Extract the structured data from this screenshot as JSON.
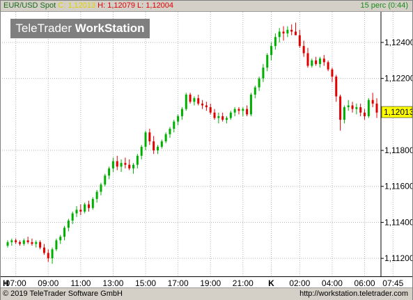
{
  "header": {
    "symbol": "EUR/USD Spot",
    "close": "C: 1,12013",
    "high": "H: 1,12079",
    "low": "L: 1,12004",
    "interval": "15 perc (0:44)"
  },
  "logo": {
    "part1": "TeleTrader ",
    "part2": "WorkStation"
  },
  "footer": {
    "copyright": "© 2019 TeleTrader Software GmbH",
    "url": "http://workstation.teletrader.com"
  },
  "colors": {
    "up": "#00b000",
    "down": "#e00000",
    "grid": "#b4b4b4",
    "price_tag": "#ffff00"
  },
  "chart_data": {
    "type": "candlestick",
    "title": "EUR/USD Spot",
    "interval": "15 perc",
    "last_price_label": "1,12013",
    "last_price": 1.12013,
    "ylim": [
      1.111,
      1.1257
    ],
    "y_ticks": [
      {
        "value": 1.124,
        "label": "1,12400"
      },
      {
        "value": 1.122,
        "label": "1,12200"
      },
      {
        "value": 1.118,
        "label": "1,11800"
      },
      {
        "value": 1.116,
        "label": "1,11600"
      },
      {
        "value": 1.114,
        "label": "1,11400"
      },
      {
        "value": 1.112,
        "label": "1,11200"
      }
    ],
    "x_ticks": [
      {
        "index": 0,
        "label": "H"
      },
      {
        "index": 2,
        "label": "07:00"
      },
      {
        "index": 10,
        "label": "09:00"
      },
      {
        "index": 18,
        "label": "11:00"
      },
      {
        "index": 26,
        "label": "13:00"
      },
      {
        "index": 34,
        "label": "15:00"
      },
      {
        "index": 42,
        "label": "17:00"
      },
      {
        "index": 50,
        "label": "19:00"
      },
      {
        "index": 58,
        "label": "21:00"
      },
      {
        "index": 65,
        "label": "K"
      },
      {
        "index": 72,
        "label": "02:00"
      },
      {
        "index": 80,
        "label": "04:00"
      },
      {
        "index": 88,
        "label": "06:00"
      },
      {
        "index": 95,
        "label": "07:45"
      }
    ],
    "grid": true,
    "candles": [
      [
        1.1127,
        1.113,
        1.1126,
        1.1129
      ],
      [
        1.1129,
        1.1131,
        1.1127,
        1.113
      ],
      [
        1.113,
        1.1131,
        1.1128,
        1.1129
      ],
      [
        1.1129,
        1.113,
        1.1127,
        1.1128
      ],
      [
        1.1128,
        1.1131,
        1.1127,
        1.113
      ],
      [
        1.113,
        1.1132,
        1.1128,
        1.1129
      ],
      [
        1.1129,
        1.1131,
        1.1127,
        1.1128
      ],
      [
        1.1128,
        1.113,
        1.1126,
        1.1129
      ],
      [
        1.1129,
        1.113,
        1.1125,
        1.1126
      ],
      [
        1.1126,
        1.1128,
        1.1122,
        1.1123
      ],
      [
        1.1123,
        1.1125,
        1.1118,
        1.112
      ],
      [
        1.112,
        1.1126,
        1.1117,
        1.1125
      ],
      [
        1.1125,
        1.1131,
        1.1124,
        1.113
      ],
      [
        1.113,
        1.1133,
        1.1128,
        1.1132
      ],
      [
        1.1132,
        1.1138,
        1.113,
        1.1137
      ],
      [
        1.1137,
        1.1142,
        1.1135,
        1.1141
      ],
      [
        1.1141,
        1.1146,
        1.1139,
        1.1145
      ],
      [
        1.1145,
        1.1149,
        1.1143,
        1.1147
      ],
      [
        1.1147,
        1.115,
        1.1144,
        1.1146
      ],
      [
        1.1146,
        1.1151,
        1.1145,
        1.115
      ],
      [
        1.115,
        1.1152,
        1.1146,
        1.1148
      ],
      [
        1.1148,
        1.1154,
        1.1147,
        1.1153
      ],
      [
        1.1153,
        1.1158,
        1.1151,
        1.1157
      ],
      [
        1.1157,
        1.1162,
        1.1155,
        1.1161
      ],
      [
        1.1161,
        1.1167,
        1.116,
        1.1166
      ],
      [
        1.1166,
        1.1171,
        1.1164,
        1.117
      ],
      [
        1.117,
        1.1176,
        1.1168,
        1.1174
      ],
      [
        1.1174,
        1.1177,
        1.1169,
        1.1171
      ],
      [
        1.1171,
        1.1175,
        1.1168,
        1.1173
      ],
      [
        1.1173,
        1.1176,
        1.117,
        1.1172
      ],
      [
        1.1172,
        1.1175,
        1.1169,
        1.117
      ],
      [
        1.117,
        1.1173,
        1.1167,
        1.1172
      ],
      [
        1.1172,
        1.1178,
        1.117,
        1.1177
      ],
      [
        1.1177,
        1.1183,
        1.1175,
        1.1182
      ],
      [
        1.1182,
        1.1191,
        1.118,
        1.119
      ],
      [
        1.119,
        1.1192,
        1.1183,
        1.1185
      ],
      [
        1.1185,
        1.1188,
        1.1178,
        1.118
      ],
      [
        1.118,
        1.1183,
        1.1178,
        1.1182
      ],
      [
        1.1182,
        1.1186,
        1.1181,
        1.1185
      ],
      [
        1.1185,
        1.119,
        1.1184,
        1.1189
      ],
      [
        1.1189,
        1.1193,
        1.1187,
        1.1192
      ],
      [
        1.1192,
        1.1197,
        1.119,
        1.1196
      ],
      [
        1.1196,
        1.12,
        1.1194,
        1.1199
      ],
      [
        1.1199,
        1.1204,
        1.1197,
        1.1203
      ],
      [
        1.1203,
        1.1212,
        1.1202,
        1.1211
      ],
      [
        1.1211,
        1.1212,
        1.1206,
        1.1207
      ],
      [
        1.1207,
        1.121,
        1.1205,
        1.1209
      ],
      [
        1.1209,
        1.1211,
        1.1205,
        1.1206
      ],
      [
        1.1206,
        1.1208,
        1.1203,
        1.1205
      ],
      [
        1.1205,
        1.1207,
        1.1202,
        1.1204
      ],
      [
        1.1204,
        1.1206,
        1.12,
        1.1201
      ],
      [
        1.1201,
        1.1203,
        1.1197,
        1.1198
      ],
      [
        1.1198,
        1.1201,
        1.1195,
        1.1199
      ],
      [
        1.1199,
        1.1201,
        1.1196,
        1.1197
      ],
      [
        1.1197,
        1.1199,
        1.1195,
        1.1198
      ],
      [
        1.1198,
        1.1202,
        1.1197,
        1.1201
      ],
      [
        1.1201,
        1.1204,
        1.1199,
        1.1203
      ],
      [
        1.1203,
        1.1204,
        1.12,
        1.1202
      ],
      [
        1.1202,
        1.1204,
        1.1199,
        1.1203
      ],
      [
        1.1203,
        1.1205,
        1.1199,
        1.12
      ],
      [
        1.12,
        1.1212,
        1.1199,
        1.1211
      ],
      [
        1.1211,
        1.1216,
        1.1209,
        1.1215
      ],
      [
        1.1215,
        1.1221,
        1.1213,
        1.122
      ],
      [
        1.122,
        1.1228,
        1.1218,
        1.1226
      ],
      [
        1.1226,
        1.1234,
        1.1224,
        1.1233
      ],
      [
        1.1233,
        1.124,
        1.123,
        1.1238
      ],
      [
        1.1238,
        1.1245,
        1.1236,
        1.1243
      ],
      [
        1.1243,
        1.1248,
        1.124,
        1.1246
      ],
      [
        1.1246,
        1.1249,
        1.1241,
        1.1245
      ],
      [
        1.1245,
        1.1249,
        1.1243,
        1.1247
      ],
      [
        1.1247,
        1.125,
        1.1244,
        1.1246
      ],
      [
        1.1246,
        1.1251,
        1.1245,
        1.1244
      ],
      [
        1.1244,
        1.1247,
        1.1237,
        1.1238
      ],
      [
        1.1238,
        1.1241,
        1.1232,
        1.1234
      ],
      [
        1.1234,
        1.1237,
        1.1226,
        1.1227
      ],
      [
        1.1227,
        1.1231,
        1.1226,
        1.123
      ],
      [
        1.123,
        1.1232,
        1.1227,
        1.1228
      ],
      [
        1.1228,
        1.1232,
        1.1226,
        1.1231
      ],
      [
        1.1231,
        1.1233,
        1.1227,
        1.1229
      ],
      [
        1.1229,
        1.123,
        1.1224,
        1.1225
      ],
      [
        1.1225,
        1.1226,
        1.1218,
        1.1221
      ],
      [
        1.1221,
        1.1222,
        1.1207,
        1.121
      ],
      [
        1.121,
        1.1211,
        1.1191,
        1.1197
      ],
      [
        1.1197,
        1.1205,
        1.1195,
        1.1204
      ],
      [
        1.1204,
        1.1208,
        1.1202,
        1.1205
      ],
      [
        1.1205,
        1.1207,
        1.1201,
        1.1203
      ],
      [
        1.1203,
        1.1206,
        1.12,
        1.1204
      ],
      [
        1.1204,
        1.1206,
        1.1199,
        1.1201
      ],
      [
        1.1201,
        1.1203,
        1.1197,
        1.1199
      ],
      [
        1.1199,
        1.1209,
        1.1198,
        1.1208
      ],
      [
        1.1208,
        1.1212,
        1.1204,
        1.1206
      ],
      [
        1.1206,
        1.1209,
        1.1198,
        1.1201
      ]
    ]
  }
}
